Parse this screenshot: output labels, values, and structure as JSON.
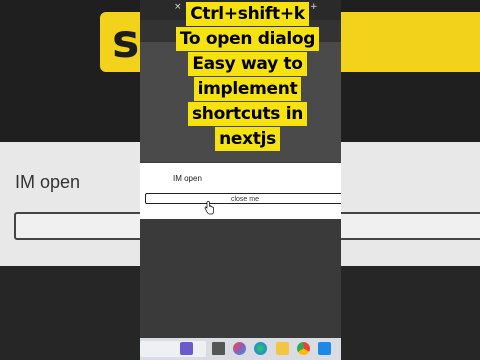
{
  "background": {
    "banner_text": "sh    n",
    "dialog_text": "IM open"
  },
  "browser": {
    "tab_close": "×",
    "tab_new": "+"
  },
  "dialog": {
    "message": "IM open",
    "close_button": "close me"
  },
  "caption": {
    "lines": [
      "Ctrl+shift+k",
      "To open dialog",
      "Easy way to",
      "implement",
      "shortcuts in",
      "nextjs"
    ]
  },
  "taskbar": {
    "icons": [
      "task-view-icon",
      "copilot-icon",
      "edge-icon",
      "file-explorer-icon",
      "chrome-icon",
      "vscode-icon"
    ]
  },
  "colors": {
    "caption_bg": "#f5e20f",
    "banner_bg": "#f2d21b"
  }
}
